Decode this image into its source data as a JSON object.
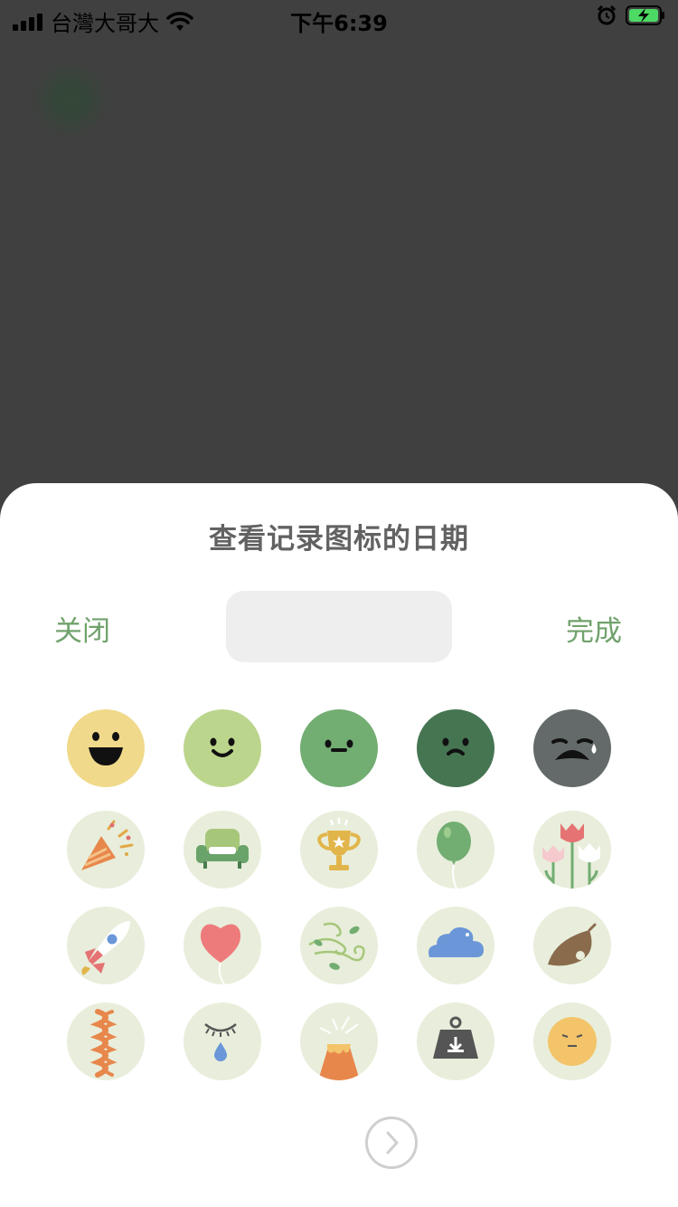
{
  "status_bar": {
    "carrier": "台灣大哥大",
    "time": "下午6:39"
  },
  "sheet": {
    "title": "查看记录图标的日期",
    "close_label": "关闭",
    "done_label": "完成"
  },
  "icons": [
    "grin-face-icon",
    "smile-face-icon",
    "neutral-face-icon",
    "frown-face-icon",
    "crying-face-icon",
    "party-popper-icon",
    "sofa-icon",
    "trophy-icon",
    "balloon-icon",
    "tulips-icon",
    "rocket-icon",
    "heart-balloon-icon",
    "wind-leaves-icon",
    "cloud-icon",
    "dry-leaf-icon",
    "twisted-rope-icon",
    "closed-eye-tear-icon",
    "volcano-icon",
    "weight-icon",
    "sleepy-face-icon"
  ],
  "colors": {
    "accent_green": "#71a26c",
    "icon_bg": "#e8eedb",
    "mood_1": "#f0d98a",
    "mood_2": "#bcd58d",
    "mood_3": "#72ad72",
    "mood_4": "#467552",
    "mood_5": "#646a69"
  }
}
